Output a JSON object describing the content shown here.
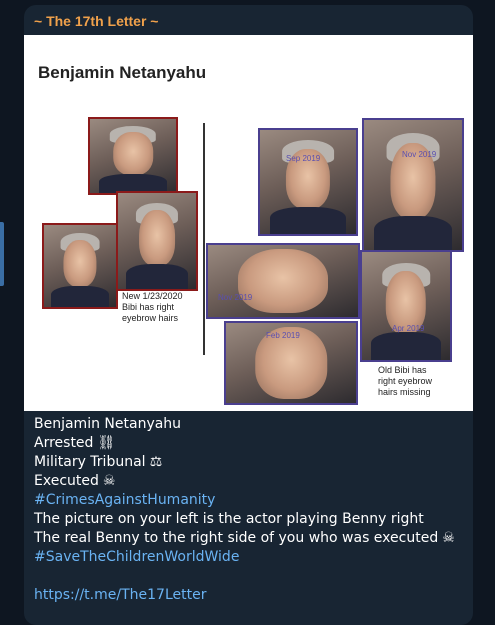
{
  "channel": {
    "name": "~ The 17th Letter ~"
  },
  "media": {
    "title": "Benjamin Netanyahu",
    "left_caption": [
      "New 1/23/2020",
      "Bibi has right",
      "eyebrow hairs"
    ],
    "right_caption": [
      "Old Bibi has",
      "right eyebrow",
      "hairs missing"
    ],
    "photo_labels": {
      "sep2019": "Sep 2019",
      "nov2019a": "Nov 2019",
      "nov2019b": "Nov 2019",
      "apr2019": "Apr 2019",
      "feb2019": "Feb 2019"
    }
  },
  "message": {
    "line1": "Benjamin Netanyahu",
    "line2": "Arrested",
    "line2_emoji": "⛓",
    "line3": "Military Tribunal",
    "line3_emoji": "⚖",
    "line4": "Executed",
    "line4_emoji": "☠",
    "hashtag1": "#CrimesAgainstHumanity",
    "line5": "The picture on your left is the actor playing Benny right",
    "line6": "The real Benny to the right side of you who was executed",
    "line6_emoji": "☠",
    "hashtag2": "#SaveTheChildrenWorldWide",
    "link": "https://t.me/The17Letter"
  }
}
